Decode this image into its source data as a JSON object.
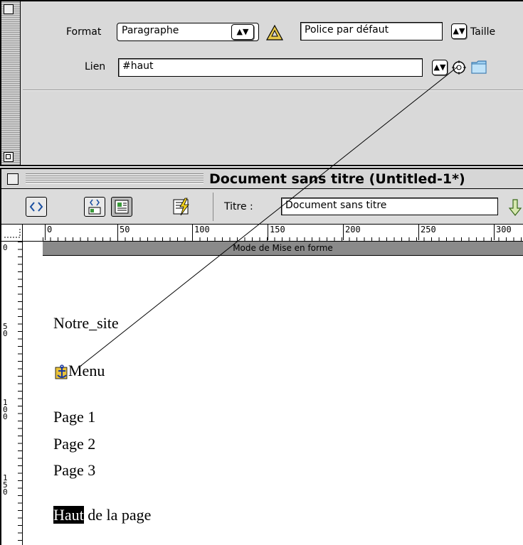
{
  "properties": {
    "format_label": "Format",
    "format_value": "Paragraphe",
    "font_value": "Police par défaut",
    "size_label": "Taille",
    "link_label": "Lien",
    "link_value": "#haut"
  },
  "document": {
    "title": "Document sans titre (Untitled-1*)",
    "titre_label": "Titre :",
    "titre_value": "Document sans titre",
    "mode_label": "Mode de Mise en forme",
    "ruler_h": [
      "0",
      "50",
      "100",
      "150",
      "200",
      "250",
      "300"
    ],
    "ruler_v": [
      [
        "0"
      ],
      [
        "5",
        "0"
      ],
      [
        "1",
        "0",
        "0"
      ],
      [
        "1",
        "5",
        "0"
      ]
    ],
    "content": {
      "site_name": "Notre_site",
      "menu": "Menu",
      "pages": [
        "Page 1",
        "Page 2",
        "Page 3"
      ],
      "anchor_word": "Haut",
      "anchor_rest": " de la page"
    }
  },
  "colors": {
    "palette_bg": "#d9d9d9",
    "mode_bar": "#8a8a8a",
    "highlight": "#000000"
  }
}
